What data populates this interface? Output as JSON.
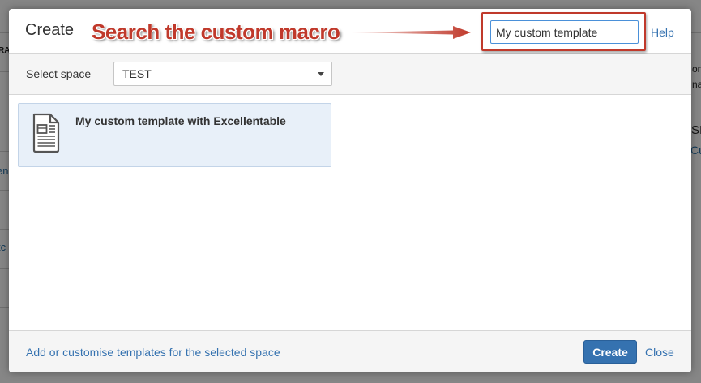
{
  "background_page": {
    "frag_left_1": "RA",
    "frag_left_2": "en",
    "frag_left_3": "tc",
    "frag_right_1": "on",
    "frag_right_2": "na",
    "frag_right_3": "SI",
    "frag_right_4": "Cu"
  },
  "dialog": {
    "title": "Create",
    "annotation": "Search the custom macro",
    "search": {
      "value": "My custom template"
    },
    "help_label": "Help",
    "space_label": "Select space",
    "space_selected": "TEST",
    "templates": [
      {
        "name": "My custom template with Excellentable",
        "icon": "document-template-icon"
      }
    ],
    "footer": {
      "customise_link": "Add or customise templates for the selected space",
      "create_label": "Create",
      "close_label": "Close"
    }
  },
  "colors": {
    "accent": "#3572b0",
    "annotation": "#c0392b",
    "selected_item_bg": "#e8f0f9"
  }
}
